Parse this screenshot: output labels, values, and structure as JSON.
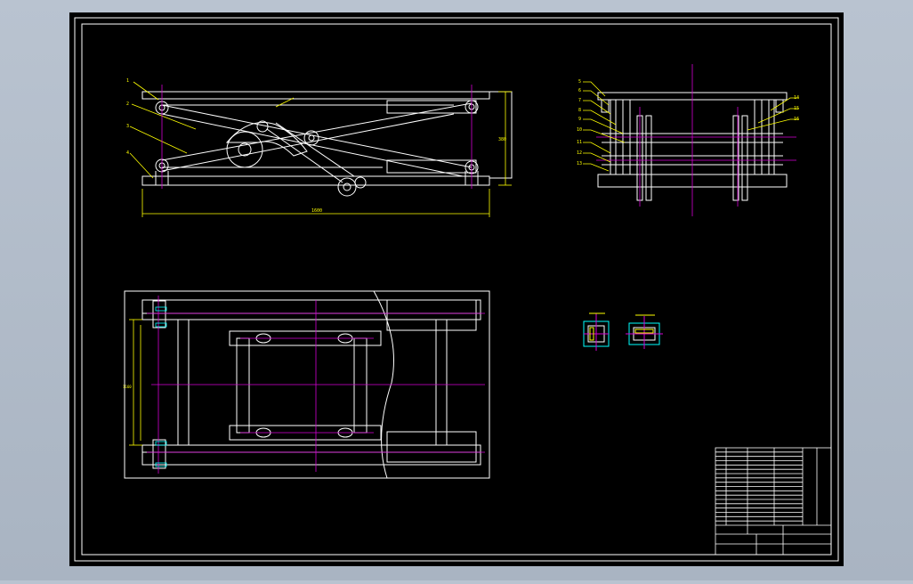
{
  "app": {
    "background_color": "#b4bfcc",
    "sheet_color": "#000000",
    "line_colors": {
      "outline": "#ffffff",
      "dimension": "#ffff00",
      "centerline": "#d400d4",
      "section": "#00ffff"
    }
  },
  "drawing": {
    "views": [
      {
        "name": "front-elevation"
      },
      {
        "name": "side-elevation"
      },
      {
        "name": "plan-view"
      },
      {
        "name": "detail-bushing-a"
      },
      {
        "name": "detail-bushing-b"
      }
    ],
    "callouts_front": [
      "1",
      "2",
      "3",
      "4"
    ],
    "callouts_side_left": [
      "5",
      "6",
      "7",
      "8",
      "9",
      "10",
      "11",
      "12",
      "13"
    ],
    "callouts_side_right": [
      "14",
      "15",
      "16"
    ],
    "dimension_overall_length": "1600",
    "dimension_height": "380",
    "dimension_plan_width": "1160"
  },
  "title_block": {
    "rows": 18
  }
}
